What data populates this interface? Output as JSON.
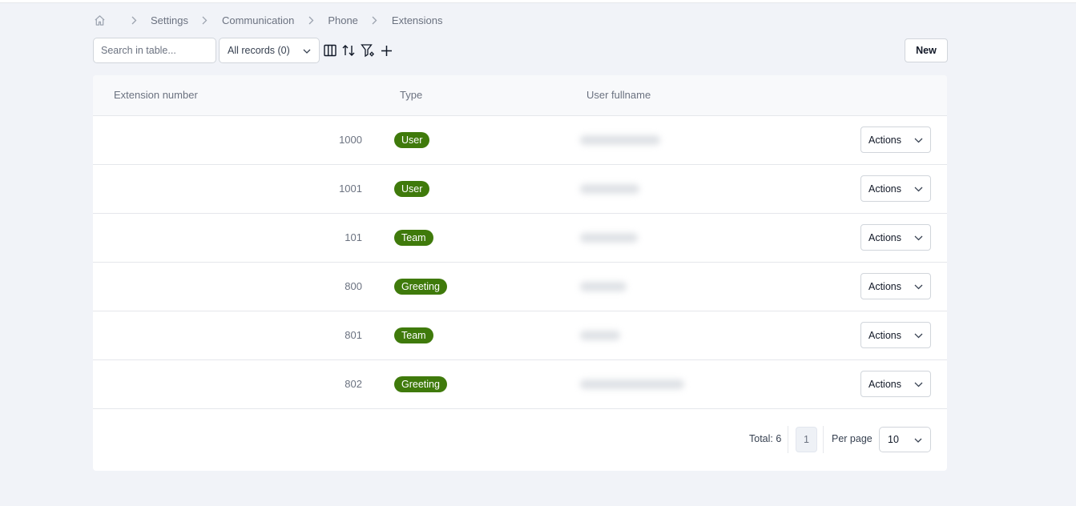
{
  "breadcrumb": {
    "items": [
      "Settings",
      "Communication",
      "Phone",
      "Extensions"
    ]
  },
  "toolbar": {
    "search_placeholder": "Search in table...",
    "records_filter": "All records (0)",
    "new_label": "New",
    "icons": [
      "columns-icon",
      "sort-icon",
      "filter-settings-icon",
      "plus-icon"
    ]
  },
  "table": {
    "columns": [
      "Extension number",
      "Type",
      "User fullname"
    ],
    "rows": [
      {
        "extension": "1000",
        "type": "User",
        "actions": "Actions"
      },
      {
        "extension": "1001",
        "type": "User",
        "actions": "Actions"
      },
      {
        "extension": "101",
        "type": "Team",
        "actions": "Actions"
      },
      {
        "extension": "800",
        "type": "Greeting",
        "actions": "Actions"
      },
      {
        "extension": "801",
        "type": "Team",
        "actions": "Actions"
      },
      {
        "extension": "802",
        "type": "Greeting",
        "actions": "Actions"
      }
    ]
  },
  "footer": {
    "total": "Total: 6",
    "page": "1",
    "per_page_label": "Per page",
    "per_page_value": "10"
  },
  "colors": {
    "badge_green": "#3f7a0b",
    "background": "#f1f3f8"
  }
}
